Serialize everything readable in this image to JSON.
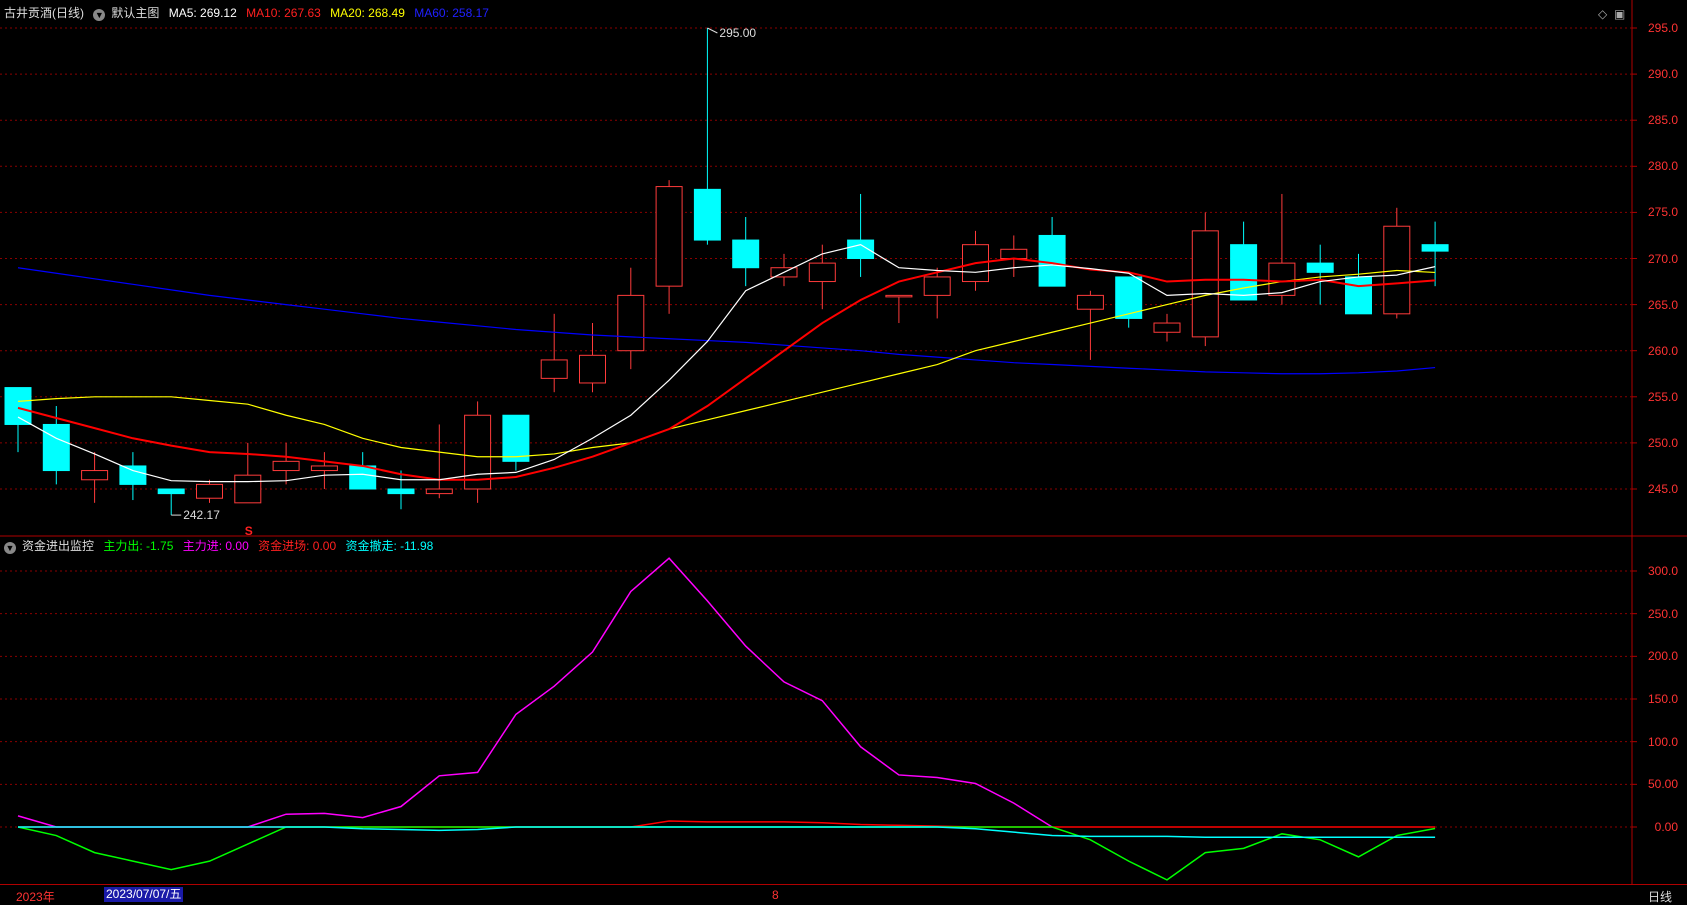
{
  "header": {
    "stock_name": "古井贡酒(日线)",
    "main_chart_label": "默认主图",
    "ma5_label": "MA5: 269.12",
    "ma10_label": "MA10: 267.63",
    "ma20_label": "MA20: 268.49",
    "ma60_label": "MA60: 258.17"
  },
  "indicator_header": {
    "name": "资金进出监控",
    "main_out": "主力出: -1.75",
    "main_in": "主力进: 0.00",
    "fund_in": "资金进场: 0.00",
    "fund_out": "资金撤走: -11.98"
  },
  "window_icons": {
    "diamond": "◇",
    "restore": "▣"
  },
  "price_axis": [
    "295.0",
    "290.0",
    "285.0",
    "280.0",
    "275.0",
    "270.0",
    "265.0",
    "260.0",
    "255.0",
    "250.0",
    "245.0"
  ],
  "indicator_axis": [
    "300.0",
    "250.0",
    "200.0",
    "150.0",
    "100.0",
    "50.00",
    "0.00"
  ],
  "annotations": {
    "high_label": "295.00",
    "low_label": "242.17",
    "signal_mark": "S"
  },
  "bottom_bar": {
    "year": "2023年",
    "cursor_date": "2023/07/07/五",
    "month": "8",
    "period": "日线"
  },
  "colors": {
    "up": "#ff3b3b",
    "down": "#00ffff",
    "ma5": "#ffffff",
    "ma10": "#ff0000",
    "ma20": "#ffff00",
    "ma60": "#0000ff",
    "grid": "#8b0000",
    "main_out": "#00ff00",
    "main_in": "#ff00ff",
    "fund_in": "#ff0000",
    "fund_out": "#00ffff"
  },
  "chart_data": {
    "type": "candlestick",
    "price_ylim": [
      240.5,
      296.0
    ],
    "indicator_ylim": [
      -70,
      330
    ],
    "candles": [
      {
        "o": 256.0,
        "h": 256.0,
        "l": 249.0,
        "c": 252.0
      },
      {
        "o": 252.0,
        "h": 254.0,
        "l": 245.5,
        "c": 247.0
      },
      {
        "o": 246.0,
        "h": 249.0,
        "l": 243.5,
        "c": 247.0
      },
      {
        "o": 247.5,
        "h": 249.0,
        "l": 243.8,
        "c": 245.5
      },
      {
        "o": 245.0,
        "h": 245.0,
        "l": 242.17,
        "c": 244.5
      },
      {
        "o": 244.0,
        "h": 246.0,
        "l": 243.5,
        "c": 245.5
      },
      {
        "o": 243.5,
        "h": 250.0,
        "l": 243.5,
        "c": 246.5
      },
      {
        "o": 247.0,
        "h": 250.0,
        "l": 245.5,
        "c": 248.0
      },
      {
        "o": 247.0,
        "h": 249.0,
        "l": 245.0,
        "c": 247.5
      },
      {
        "o": 247.5,
        "h": 249.0,
        "l": 245.0,
        "c": 245.0
      },
      {
        "o": 245.0,
        "h": 247.0,
        "l": 242.8,
        "c": 244.5
      },
      {
        "o": 244.5,
        "h": 252.0,
        "l": 244.0,
        "c": 245.0
      },
      {
        "o": 245.0,
        "h": 254.5,
        "l": 243.5,
        "c": 253.0
      },
      {
        "o": 253.0,
        "h": 253.0,
        "l": 247.0,
        "c": 248.0
      },
      {
        "o": 257.0,
        "h": 264.0,
        "l": 255.5,
        "c": 259.0
      },
      {
        "o": 256.5,
        "h": 263.0,
        "l": 255.5,
        "c": 259.5
      },
      {
        "o": 260.0,
        "h": 269.0,
        "l": 258.0,
        "c": 266.0
      },
      {
        "o": 267.0,
        "h": 278.5,
        "l": 264.0,
        "c": 277.8
      },
      {
        "o": 277.5,
        "h": 295.0,
        "l": 271.5,
        "c": 272.0
      },
      {
        "o": 272.0,
        "h": 274.5,
        "l": 267.0,
        "c": 269.0
      },
      {
        "o": 268.0,
        "h": 270.5,
        "l": 267.0,
        "c": 269.0
      },
      {
        "o": 267.5,
        "h": 271.5,
        "l": 264.5,
        "c": 269.5
      },
      {
        "o": 272.0,
        "h": 277.0,
        "l": 268.0,
        "c": 270.0
      },
      {
        "o": 266.0,
        "h": 266.0,
        "l": 263.0,
        "c": 266.0
      },
      {
        "o": 266.0,
        "h": 269.0,
        "l": 263.5,
        "c": 268.0
      },
      {
        "o": 267.5,
        "h": 273.0,
        "l": 266.5,
        "c": 271.5
      },
      {
        "o": 270.0,
        "h": 272.5,
        "l": 268.0,
        "c": 271.0
      },
      {
        "o": 272.5,
        "h": 274.5,
        "l": 267.0,
        "c": 267.0
      },
      {
        "o": 264.5,
        "h": 266.5,
        "l": 259.0,
        "c": 266.0
      },
      {
        "o": 268.0,
        "h": 268.0,
        "l": 262.5,
        "c": 263.5
      },
      {
        "o": 262.0,
        "h": 264.0,
        "l": 261.0,
        "c": 263.0
      },
      {
        "o": 261.5,
        "h": 275.0,
        "l": 260.5,
        "c": 273.0
      },
      {
        "o": 271.5,
        "h": 274.0,
        "l": 265.5,
        "c": 265.5
      },
      {
        "o": 266.0,
        "h": 277.0,
        "l": 265.0,
        "c": 269.5
      },
      {
        "o": 269.5,
        "h": 271.5,
        "l": 265.0,
        "c": 268.5
      },
      {
        "o": 268.0,
        "h": 270.5,
        "l": 264.0,
        "c": 264.0
      },
      {
        "o": 264.0,
        "h": 275.5,
        "l": 263.5,
        "c": 273.5
      },
      {
        "o": 271.5,
        "h": 274.0,
        "l": 267.0,
        "c": 270.8
      }
    ],
    "ma5": [
      252.8,
      250.5,
      248.8,
      247.0,
      245.9,
      245.8,
      245.8,
      245.9,
      246.5,
      246.6,
      246.0,
      246.0,
      246.6,
      246.8,
      248.2,
      250.5,
      253.0,
      256.8,
      261.0,
      266.5,
      268.5,
      270.5,
      271.5,
      269.0,
      268.7,
      268.5,
      269.0,
      269.3,
      268.9,
      268.4,
      266.0,
      266.2,
      266.0,
      266.3,
      267.5,
      268.0,
      268.2,
      269.12
    ],
    "ma10": [
      253.8,
      252.7,
      251.6,
      250.5,
      249.7,
      249.0,
      248.8,
      248.5,
      248.0,
      247.5,
      246.6,
      246.0,
      246.0,
      246.3,
      247.3,
      248.5,
      250.0,
      251.5,
      254.0,
      257.0,
      260.0,
      263.0,
      265.5,
      267.5,
      268.5,
      269.5,
      270.0,
      269.5,
      268.8,
      268.5,
      267.5,
      267.7,
      267.7,
      267.5,
      267.7,
      267.0,
      267.3,
      267.63
    ],
    "ma20": [
      254.5,
      254.8,
      255.0,
      255.0,
      255.0,
      254.6,
      254.2,
      253.0,
      252.0,
      250.5,
      249.5,
      249.0,
      248.5,
      248.5,
      248.8,
      249.5,
      250.0,
      251.5,
      252.5,
      253.5,
      254.5,
      255.5,
      256.5,
      257.5,
      258.5,
      260.0,
      261.0,
      262.0,
      263.0,
      264.0,
      265.0,
      266.0,
      266.8,
      267.5,
      268.0,
      268.3,
      268.7,
      268.49
    ],
    "ma60": [
      269.0,
      268.4,
      267.8,
      267.2,
      266.6,
      266.0,
      265.5,
      265.0,
      264.5,
      264.0,
      263.5,
      263.1,
      262.7,
      262.3,
      262.0,
      261.7,
      261.5,
      261.3,
      261.1,
      260.9,
      260.6,
      260.3,
      260.0,
      259.6,
      259.3,
      259.0,
      258.7,
      258.5,
      258.3,
      258.1,
      257.9,
      257.7,
      257.6,
      257.5,
      257.5,
      257.6,
      257.8,
      258.17
    ],
    "main_out": [
      0,
      -10,
      -30,
      -40,
      -50,
      -40,
      -20,
      0,
      0,
      0,
      0,
      0,
      0,
      0,
      0,
      0,
      0,
      0,
      0,
      0,
      0,
      0,
      0,
      0,
      0,
      0,
      0,
      0,
      -15,
      -40,
      -62,
      -30,
      -25,
      -8,
      -15,
      -35,
      -10,
      -1.75
    ],
    "main_in": [
      13,
      0,
      0,
      0,
      0,
      0,
      0,
      15,
      16,
      11,
      24,
      60,
      64,
      132,
      165,
      205,
      276,
      315,
      265,
      212,
      170,
      148,
      94,
      61,
      58,
      51,
      28,
      0,
      0,
      0,
      0,
      0,
      0,
      0,
      0,
      0,
      0,
      0
    ],
    "fund_in": [
      0,
      0,
      0,
      0,
      0,
      0,
      0,
      0,
      0,
      0,
      0,
      0,
      0,
      0,
      0,
      0,
      0,
      7,
      6,
      6,
      6,
      5,
      3,
      2,
      1,
      0,
      0,
      0,
      0,
      0,
      0,
      0,
      0,
      0,
      0,
      0,
      0,
      0
    ],
    "fund_out": [
      0,
      0,
      0,
      0,
      0,
      0,
      0,
      0,
      0,
      -2,
      -3,
      -4,
      -3,
      0,
      0,
      0,
      0,
      0,
      0,
      0,
      0,
      0,
      0,
      0,
      0,
      -2,
      -6,
      -10,
      -11,
      -11,
      -11,
      -12,
      -12,
      -12,
      -12,
      -12,
      -12,
      -11.98
    ]
  }
}
